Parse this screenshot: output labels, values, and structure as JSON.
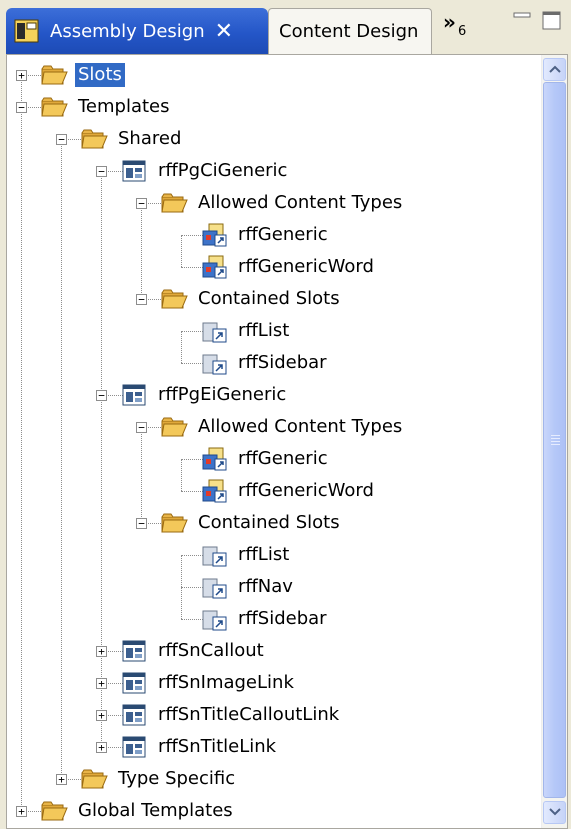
{
  "tabs": {
    "active_label": "Assembly Design",
    "close_glyph": "✕",
    "inactive_label": "Content Design",
    "overflow_glyph": "»",
    "overflow_count": "6"
  },
  "colors": {
    "active_tab": "#2456c8",
    "selection": "#316ac5",
    "folder": "#f3c85a"
  },
  "tree": [
    {
      "label": "Slots",
      "icon": "folder-icon",
      "selected": true
    },
    {
      "label": "Templates",
      "icon": "folder-icon"
    },
    {
      "label": "Shared",
      "icon": "folder-icon"
    },
    {
      "label": "rffPgCiGeneric",
      "icon": "template-icon"
    },
    {
      "label": "Allowed Content Types",
      "icon": "folder-icon"
    },
    {
      "label": "rffGeneric",
      "icon": "content-type-icon"
    },
    {
      "label": "rffGenericWord",
      "icon": "content-type-icon"
    },
    {
      "label": "Contained Slots",
      "icon": "folder-icon"
    },
    {
      "label": "rffList",
      "icon": "slot-icon"
    },
    {
      "label": "rffSidebar",
      "icon": "slot-icon"
    },
    {
      "label": "rffPgEiGeneric",
      "icon": "template-icon"
    },
    {
      "label": "Allowed Content Types",
      "icon": "folder-icon"
    },
    {
      "label": "rffGeneric",
      "icon": "content-type-icon"
    },
    {
      "label": "rffGenericWord",
      "icon": "content-type-icon"
    },
    {
      "label": "Contained Slots",
      "icon": "folder-icon"
    },
    {
      "label": "rffList",
      "icon": "slot-icon"
    },
    {
      "label": "rffNav",
      "icon": "slot-icon"
    },
    {
      "label": "rffSidebar",
      "icon": "slot-icon"
    },
    {
      "label": "rffSnCallout",
      "icon": "template-icon"
    },
    {
      "label": "rffSnImageLink",
      "icon": "template-icon"
    },
    {
      "label": "rffSnTitleCalloutLink",
      "icon": "template-icon"
    },
    {
      "label": "rffSnTitleLink",
      "icon": "template-icon"
    },
    {
      "label": "Type Specific",
      "icon": "folder-icon"
    },
    {
      "label": "Global Templates",
      "icon": "folder-icon"
    }
  ]
}
